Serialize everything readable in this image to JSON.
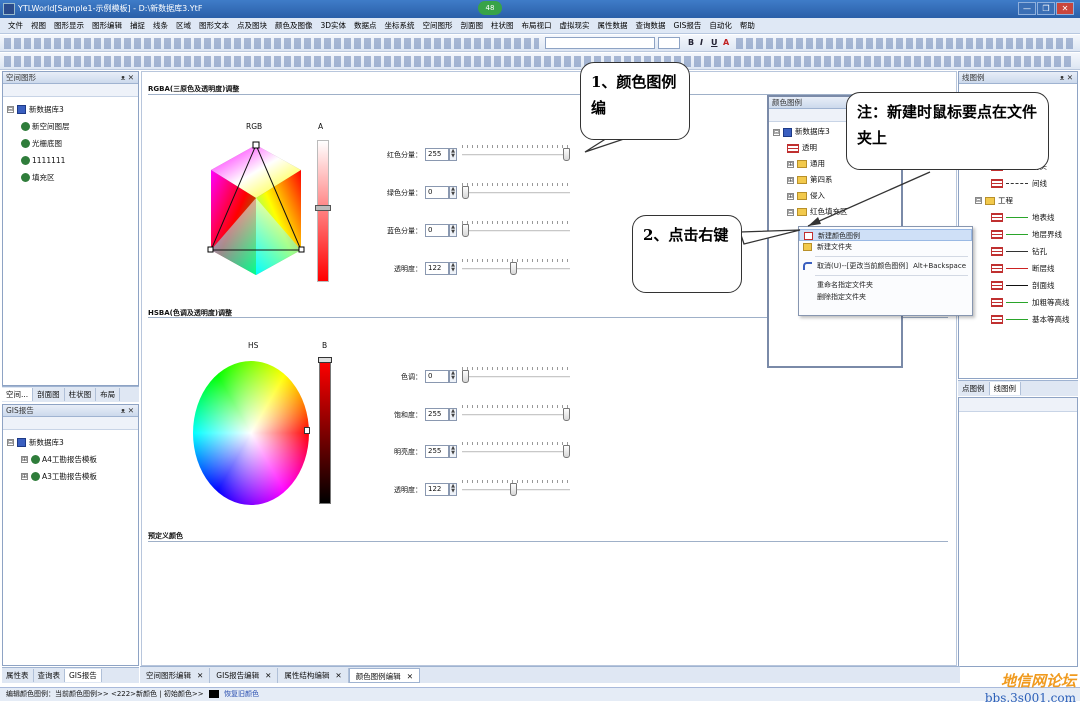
{
  "titlebar": {
    "title": "YTLWorld[Sample1-示例模板] - D:\\新数据库3.YtF",
    "badge": "48",
    "minimize": "—",
    "restore": "❐",
    "close": "✕"
  },
  "menu": [
    "文件",
    "视图",
    "图形显示",
    "图形编辑",
    "捕捉",
    "线条",
    "区域",
    "图形文本",
    "点及图块",
    "颜色及图像",
    "3D实体",
    "数据点",
    "坐标系统",
    "空间图形",
    "剖面图",
    "柱状图",
    "布局视口",
    "虚拟现实",
    "属性数据",
    "查询数据",
    "GIS报告",
    "自动化",
    "帮助"
  ],
  "toolbar": {
    "bold": "B",
    "italic": "I",
    "underline": "U",
    "fontcolor": "A"
  },
  "left_top_panel": {
    "title": "空间图形",
    "pin": "ᴥ ✕",
    "tree": [
      {
        "label": "新数据库3",
        "level": 0,
        "icon": "database-icon",
        "expander": "⊟"
      },
      {
        "label": "新空间图层",
        "level": 1,
        "icon": "layer-icon"
      },
      {
        "label": "光栅底图",
        "level": 1,
        "icon": "layer-icon"
      },
      {
        "label": "1111111",
        "level": 1,
        "icon": "layer-icon"
      },
      {
        "label": "填充区",
        "level": 1,
        "icon": "layer-icon"
      }
    ],
    "tabs": [
      "空间...",
      "剖面图",
      "柱状图",
      "布局"
    ]
  },
  "left_bottom_panel": {
    "title": "GIS报告",
    "pin": "ᴥ ✕",
    "tree": [
      {
        "label": "新数据库3",
        "level": 0,
        "icon": "database-icon",
        "expander": "⊟"
      },
      {
        "label": "A4工勘报告模板",
        "level": 1,
        "icon": "report-icon",
        "expander": "⊞"
      },
      {
        "label": "A3工勘报告模板",
        "level": 1,
        "icon": "report-icon",
        "expander": "⊞"
      }
    ],
    "tabs": [
      "属性表",
      "查询表",
      "GIS报告"
    ]
  },
  "editor": {
    "rgba_title": "RGBA(三原色及透明度)调整",
    "rgb_label": "RGB",
    "alpha_label": "A",
    "rgba_controls": [
      {
        "label": "红色分量：",
        "value": "255",
        "fraction": 1.0
      },
      {
        "label": "绿色分量：",
        "value": "0",
        "fraction": 0.0
      },
      {
        "label": "蓝色分量：",
        "value": "0",
        "fraction": 0.0
      },
      {
        "label": "透明度：",
        "value": "122",
        "fraction": 0.48
      }
    ],
    "hsba_title": "HSBA(色调及透明度)调整",
    "hs_label": "HS",
    "b_label": "B",
    "hsba_controls": [
      {
        "label": "色调：",
        "value": "0",
        "fraction": 0.0
      },
      {
        "label": "饱和度：",
        "value": "255",
        "fraction": 1.0
      },
      {
        "label": "明亮度：",
        "value": "255",
        "fraction": 1.0
      },
      {
        "label": "透明度：",
        "value": "122",
        "fraction": 0.48
      }
    ],
    "preset_title": "预定义颜色",
    "spin_up": "▲",
    "spin_down": "▼"
  },
  "legend_panel": {
    "title": "颜色图例",
    "pin": "ᴥ ✕",
    "tree": [
      {
        "label": "新数据库3",
        "level": 0,
        "kind": "database",
        "expander": "⊟"
      },
      {
        "label": "透明",
        "level": 1,
        "kind": "legend"
      },
      {
        "label": "通用",
        "level": 1,
        "kind": "folder",
        "expander": "⊞"
      },
      {
        "label": "第四系",
        "level": 1,
        "kind": "folder",
        "expander": "⊞"
      },
      {
        "label": "侵入",
        "level": 1,
        "kind": "folder",
        "expander": "⊞"
      },
      {
        "label": "红色填充区",
        "level": 1,
        "kind": "folder",
        "expander": "⊟"
      }
    ]
  },
  "context_menu": {
    "items": [
      {
        "label": "新建颜色图例",
        "shortcut": "",
        "icon": "legend-icon",
        "highlight": true
      },
      {
        "label": "新建文件夹",
        "shortcut": "",
        "icon": "folder-icon"
      },
      {
        "sep": true
      },
      {
        "label": "取消(U)--[更改当前颜色图例]",
        "shortcut": "Alt+Backspace",
        "icon": "undo-icon"
      },
      {
        "sep": true
      },
      {
        "label": "重命名指定文件夹",
        "shortcut": ""
      },
      {
        "label": "删除指定文件夹",
        "shortcut": ""
      }
    ]
  },
  "line_panel": {
    "title": "线图例",
    "pin": "ᴥ ✕",
    "tree": [
      {
        "label": "箭头",
        "level": 2,
        "style": "arrow"
      },
      {
        "label": "间线",
        "level": 2,
        "style": "dashed"
      },
      {
        "label": "工程",
        "level": 1,
        "style": "folder",
        "expander": "⊟"
      },
      {
        "label": "地表线",
        "level": 2,
        "style": "green"
      },
      {
        "label": "地层界线",
        "level": 2,
        "style": "green"
      },
      {
        "label": "钻孔",
        "level": 2,
        "style": "arrowl"
      },
      {
        "label": "断层线",
        "level": 2,
        "style": "red"
      },
      {
        "label": "剖面线",
        "level": 2,
        "style": "black"
      },
      {
        "label": "加粗等高线",
        "level": 2,
        "style": "green"
      },
      {
        "label": "基本等高线",
        "level": 2,
        "style": "green"
      }
    ],
    "tabs": [
      "点图例",
      "线图例"
    ]
  },
  "doc_tabs": [
    "空间图形编辑",
    "GIS报告编辑",
    "属性结构编辑",
    "颜色图例编辑"
  ],
  "doc_tab_close": "✕",
  "status": {
    "text": "编辑颜色图例：当前颜色图例>> <222>新颜色 | 初始颜色>>",
    "restore": "恢复旧颜色"
  },
  "callouts": {
    "c1": "1、颜色图例编",
    "c2": "2、点击右键",
    "c3": "注：新建时鼠标要点在文件夹上"
  },
  "watermark": {
    "top": "地信网论坛",
    "bottom": "bbs.3s001.com"
  },
  "colors": {
    "accent": "#3f7cc8",
    "selected_color": "#ff0000"
  }
}
